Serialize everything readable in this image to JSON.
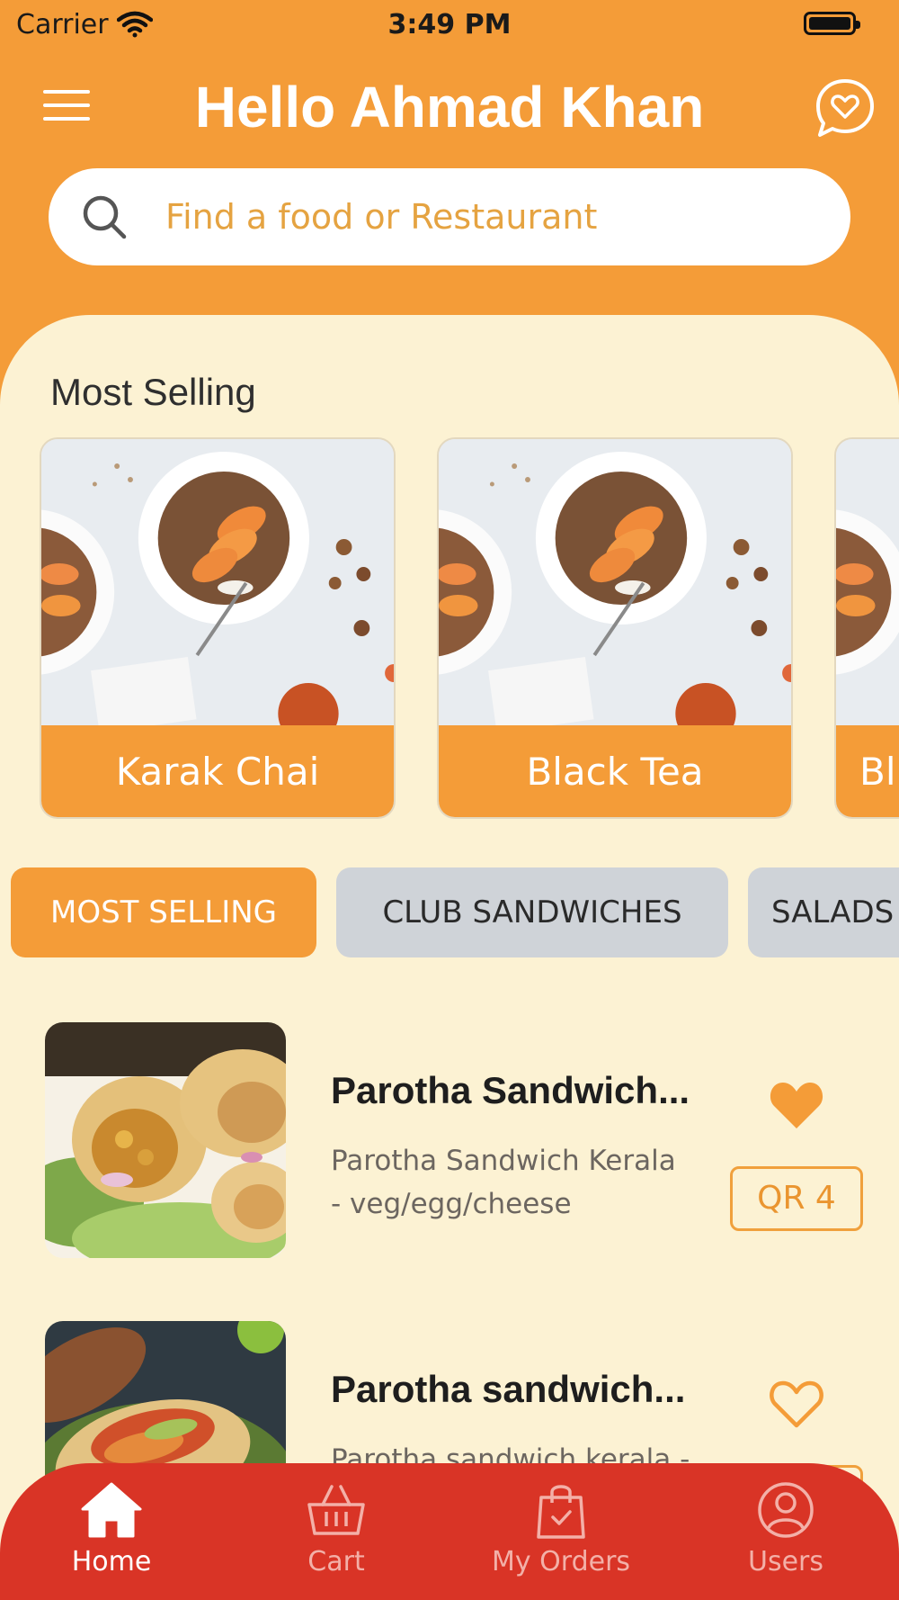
{
  "status_bar": {
    "carrier": "Carrier",
    "time": "3:49 PM"
  },
  "header": {
    "greeting": "Hello Ahmad Khan"
  },
  "search": {
    "placeholder": "Find a food or Restaurant"
  },
  "most_selling": {
    "title": "Most Selling",
    "cards": [
      {
        "label": "Karak Chai"
      },
      {
        "label": "Black Tea"
      },
      {
        "label": "Bl"
      }
    ]
  },
  "categories": [
    {
      "label": "MOST SELLING",
      "active": true
    },
    {
      "label": "CLUB SANDWICHES",
      "active": false
    },
    {
      "label": "SALADS",
      "active": false
    }
  ],
  "items": [
    {
      "name": "Parotha Sandwich...",
      "desc_line1": "Parotha Sandwich Kerala",
      "desc_line2": "- veg/egg/cheese",
      "price": "QR 4",
      "favorite": true
    },
    {
      "name": "Parotha sandwich...",
      "desc_line1": "Parotha sandwich kerala -",
      "desc_line2": "",
      "price": "",
      "favorite": false
    }
  ],
  "tab_bar": {
    "tabs": [
      {
        "label": "Home",
        "icon": "home-icon",
        "active": true
      },
      {
        "label": "Cart",
        "icon": "basket-icon",
        "active": false
      },
      {
        "label": "My Orders",
        "icon": "shopping-bag-icon",
        "active": false
      },
      {
        "label": "Users",
        "icon": "user-icon",
        "active": false
      }
    ]
  },
  "colors": {
    "primary_orange": "#f49c38",
    "content_background": "#fcf2d3",
    "tab_bar_red": "#d93426",
    "chip_inactive": "#cfd3d8",
    "price_border": "#f0a03c"
  }
}
